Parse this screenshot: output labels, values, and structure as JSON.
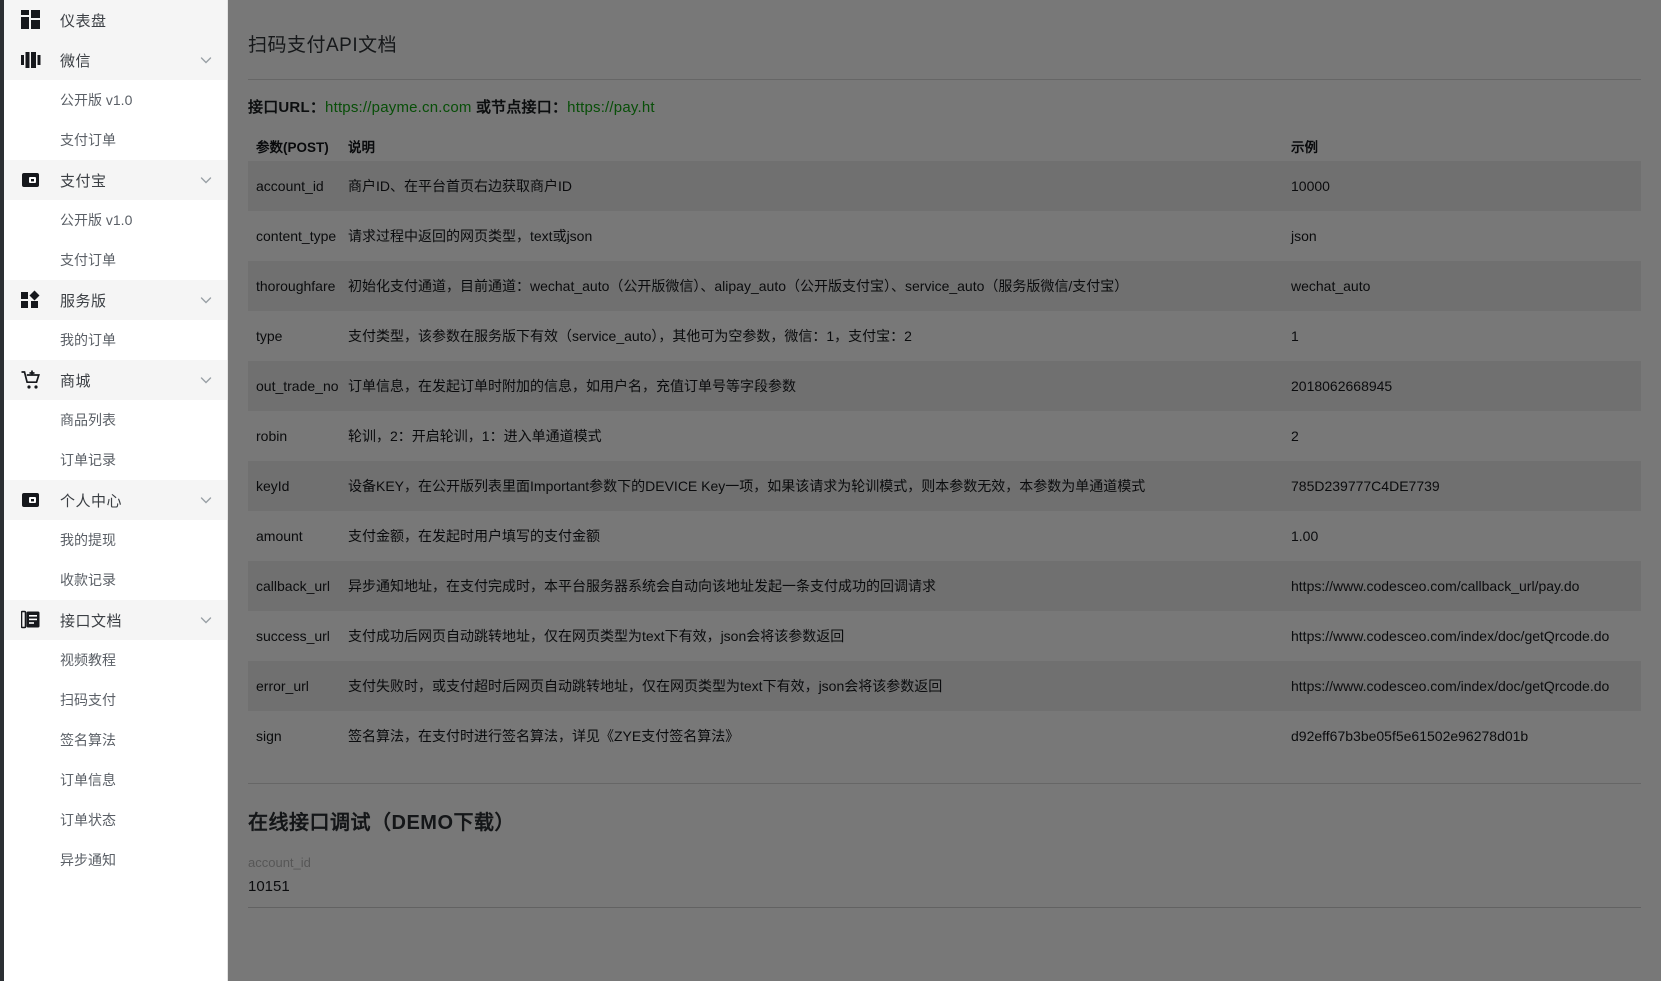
{
  "sidebar": {
    "groups": [
      {
        "icon": "dashboard-icon",
        "label": "仪表盘",
        "has_chevron": false,
        "children": []
      },
      {
        "icon": "wechat-icon",
        "label": "微信",
        "has_chevron": true,
        "children": [
          "公开版 v1.0",
          "支付订单"
        ]
      },
      {
        "icon": "alipay-icon",
        "label": "支付宝",
        "has_chevron": true,
        "children": [
          "公开版 v1.0",
          "支付订单"
        ]
      },
      {
        "icon": "service-icon",
        "label": "服务版",
        "has_chevron": true,
        "children": [
          "我的订单"
        ]
      },
      {
        "icon": "cart-icon",
        "label": "商城",
        "has_chevron": true,
        "children": [
          "商品列表",
          "订单记录"
        ]
      },
      {
        "icon": "wallet-icon",
        "label": "个人中心",
        "has_chevron": true,
        "children": [
          "我的提现",
          "收款记录"
        ]
      },
      {
        "icon": "document-icon",
        "label": "接口文档",
        "has_chevron": true,
        "children": [
          "视频教程",
          "扫码支付",
          "签名算法",
          "订单信息",
          "订单状态",
          "异步通知"
        ]
      }
    ]
  },
  "main": {
    "page_title": "扫码支付API文档",
    "url_line": {
      "label": "接口URL：",
      "url1": "https://payme.cn.com",
      "middle": " 或节点接口：",
      "url2": "https://pay.ht"
    },
    "table": {
      "headers": {
        "param": "参数(POST)",
        "desc": "说明",
        "example": "示例"
      },
      "rows": [
        {
          "param": "account_id",
          "desc": "商户ID、在平台首页右边获取商户ID",
          "example": "10000"
        },
        {
          "param": "content_type",
          "desc": "请求过程中返回的网页类型，text或json",
          "example": "json"
        },
        {
          "param": "thoroughfare",
          "desc": "初始化支付通道，目前通道：wechat_auto（公开版微信）、alipay_auto（公开版支付宝）、service_auto（服务版微信/支付宝）",
          "example": "wechat_auto"
        },
        {
          "param": "type",
          "desc": "支付类型，该参数在服务版下有效（service_auto），其他可为空参数，微信：1，支付宝：2",
          "example": "1"
        },
        {
          "param": "out_trade_no",
          "desc": "订单信息，在发起订单时附加的信息，如用户名，充值订单号等字段参数",
          "example": "2018062668945"
        },
        {
          "param": "robin",
          "desc": "轮训，2：开启轮训，1：进入单通道模式",
          "example": "2"
        },
        {
          "param": "keyId",
          "desc": "设备KEY，在公开版列表里面Important参数下的DEVICE Key一项，如果该请求为轮训模式，则本参数无效，本参数为单通道模式",
          "example": "785D239777C4DE7739"
        },
        {
          "param": "amount",
          "desc": "支付金额，在发起时用户填写的支付金额",
          "example": "1.00"
        },
        {
          "param": "callback_url",
          "desc": "异步通知地址，在支付完成时，本平台服务器系统会自动向该地址发起一条支付成功的回调请求",
          "example": "https://www.codesceo.com/callback_url/pay.do"
        },
        {
          "param": "success_url",
          "desc": "支付成功后网页自动跳转地址，仅在网页类型为text下有效，json会将该参数返回",
          "example": "https://www.codesceo.com/index/doc/getQrcode.do"
        },
        {
          "param": "error_url",
          "desc": "支付失败时，或支付超时后网页自动跳转地址，仅在网页类型为text下有效，json会将该参数返回",
          "example": "https://www.codesceo.com/index/doc/getQrcode.do"
        },
        {
          "param": "sign",
          "desc": "签名算法，在支付时进行签名算法，详见《ZYE支付签名算法》",
          "example": "d92eff67b3be05f5e61502e96278d01b"
        }
      ]
    },
    "demo": {
      "section_title": "在线接口调试（DEMO下载）",
      "account_id_label": "account_id",
      "account_id_value": "10151"
    }
  },
  "colors": {
    "link_green": "#11a611",
    "row_stripe": "#efefef",
    "backdrop": "rgba(0,0,0,0.53)"
  }
}
